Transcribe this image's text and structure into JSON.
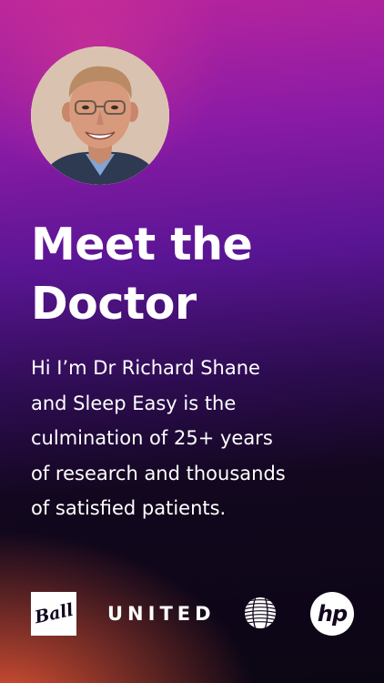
{
  "headline": {
    "line1": "Meet the",
    "line2": "Doctor"
  },
  "body": {
    "lines": [
      "Hi I’m Dr Richard Shane",
      "and Sleep Easy is the",
      "culmination of 25+ years",
      "of research and thousands",
      "of satisfied patients."
    ]
  },
  "logos": {
    "ball": "Ball",
    "united": "UNITED",
    "hp": "hp"
  },
  "colors": {
    "text": "#ffffff",
    "gradient_top": "#b9259c",
    "gradient_mid": "#5a1594",
    "gradient_dark": "#0b0614",
    "accent_orange": "#f75c38"
  }
}
